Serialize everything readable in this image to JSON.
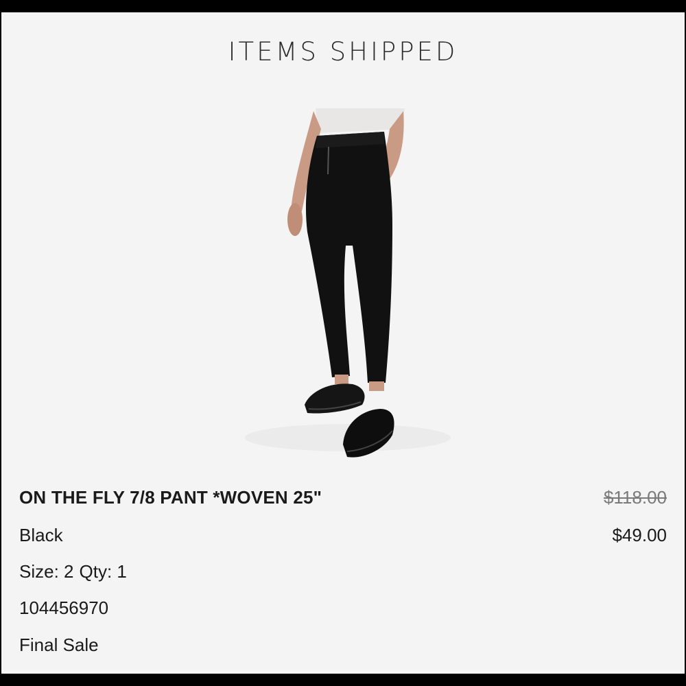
{
  "section_title": "ITEMS SHIPPED",
  "item": {
    "name": "ON THE FLY 7/8 PANT *WOVEN 25\"",
    "color": "Black",
    "size_label": "Size: 2",
    "qty_label": "Qty: 1",
    "sku": "104456970",
    "sale_note": "Final Sale",
    "original_price": "$118.00",
    "price": "$49.00"
  },
  "image": {
    "subject": "model wearing black pants and black sneakers"
  }
}
